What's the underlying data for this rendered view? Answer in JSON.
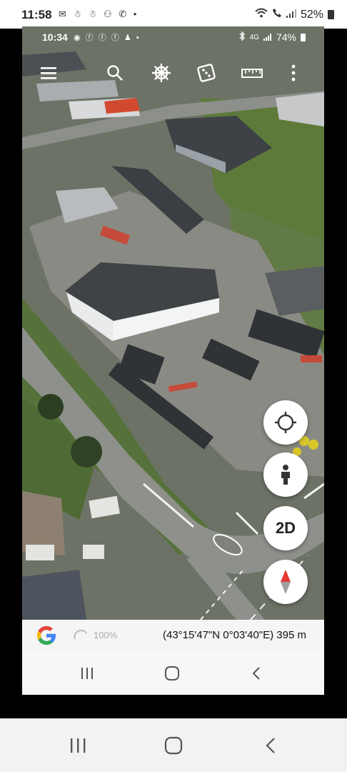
{
  "outer_status": {
    "time": "11:58",
    "notif_icons": [
      "message-icon",
      "snapchat-icon",
      "snapchat-icon",
      "people-icon",
      "whatsapp-icon",
      "dot-icon"
    ],
    "notif_glyphs": "✉ ☃ ☃ ⚇ ✆ •",
    "battery": "52%"
  },
  "inner_status": {
    "time": "10:34",
    "notif_glyphs": "◉ ⓕ ⓕ ⓕ ♟ •",
    "network": "4G",
    "battery": "74%"
  },
  "toolbar": {
    "icons": [
      "menu-icon",
      "search-icon",
      "voyager-wheel-icon",
      "dice-icon",
      "ruler-icon",
      "more-icon"
    ]
  },
  "fabs": {
    "locate": "crosshair-icon",
    "street_view": "pegman-icon",
    "view_mode_label": "2D",
    "compass": "compass-icon"
  },
  "info_strip": {
    "logo": "G",
    "zoom": "100%",
    "coords": "(43°15'47\"N 0°03'40\"E) 395 m"
  },
  "colors": {
    "aerial_ground": "#6a6f62",
    "grass": "#5d7a3a",
    "road": "#8a8c88",
    "roof": "#4a4d50",
    "compass_red": "#e53935"
  }
}
